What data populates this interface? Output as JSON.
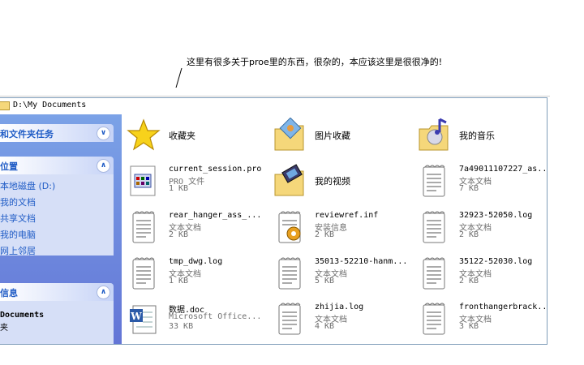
{
  "annotation": {
    "text": "这里有很多关于proe里的东西，很杂的，本应该这里是很很净的!"
  },
  "address": {
    "path": "D:\\My Documents"
  },
  "sidebar": {
    "tasks_header": "和文件夹任务",
    "places_header": "位置",
    "places": [
      "本地磁盘 (D:)",
      "我的文档",
      "共享文档",
      "我的电脑",
      "网上邻居"
    ],
    "details_header": "信息",
    "details_title": "Documents",
    "details_sub": "夹"
  },
  "files": [
    {
      "name": "收藏夹",
      "type": "",
      "size": "",
      "icon": "favorites-star-icon",
      "special": true
    },
    {
      "name": "图片收藏",
      "type": "",
      "size": "",
      "icon": "my-pictures-folder-icon",
      "special": true
    },
    {
      "name": "我的音乐",
      "type": "",
      "size": "",
      "icon": "my-music-folder-icon",
      "special": true
    },
    {
      "name": "current_session.pro",
      "type": "PRO 文件",
      "size": "1 KB",
      "icon": "pro-file-icon"
    },
    {
      "name": "我的视频",
      "type": "",
      "size": "",
      "icon": "my-videos-folder-icon",
      "special": true
    },
    {
      "name": "7a49011107227_as...",
      "type": "文本文档",
      "size": "7 KB",
      "icon": "text-document-icon"
    },
    {
      "name": "rear_hanger_ass_...",
      "type": "文本文档",
      "size": "2 KB",
      "icon": "text-document-icon"
    },
    {
      "name": "reviewref.inf",
      "type": "安装信息",
      "size": "2 KB",
      "icon": "setup-info-icon"
    },
    {
      "name": "32923-52050.log",
      "type": "文本文档",
      "size": "2 KB",
      "icon": "text-document-icon"
    },
    {
      "name": "tmp_dwg.log",
      "type": "文本文档",
      "size": "1 KB",
      "icon": "text-document-icon"
    },
    {
      "name": "35013-52210-hanm...",
      "type": "文本文档",
      "size": "5 KB",
      "icon": "text-document-icon"
    },
    {
      "name": "35122-52030.log",
      "type": "文本文档",
      "size": "2 KB",
      "icon": "text-document-icon"
    },
    {
      "name": "数据.doc",
      "type": "Microsoft Office...",
      "size": "33 KB",
      "icon": "word-document-icon"
    },
    {
      "name": "zhijia.log",
      "type": "文本文档",
      "size": "4 KB",
      "icon": "text-document-icon"
    },
    {
      "name": "fronthangerbrack...",
      "type": "文本文档",
      "size": "3 KB",
      "icon": "text-document-icon"
    }
  ]
}
